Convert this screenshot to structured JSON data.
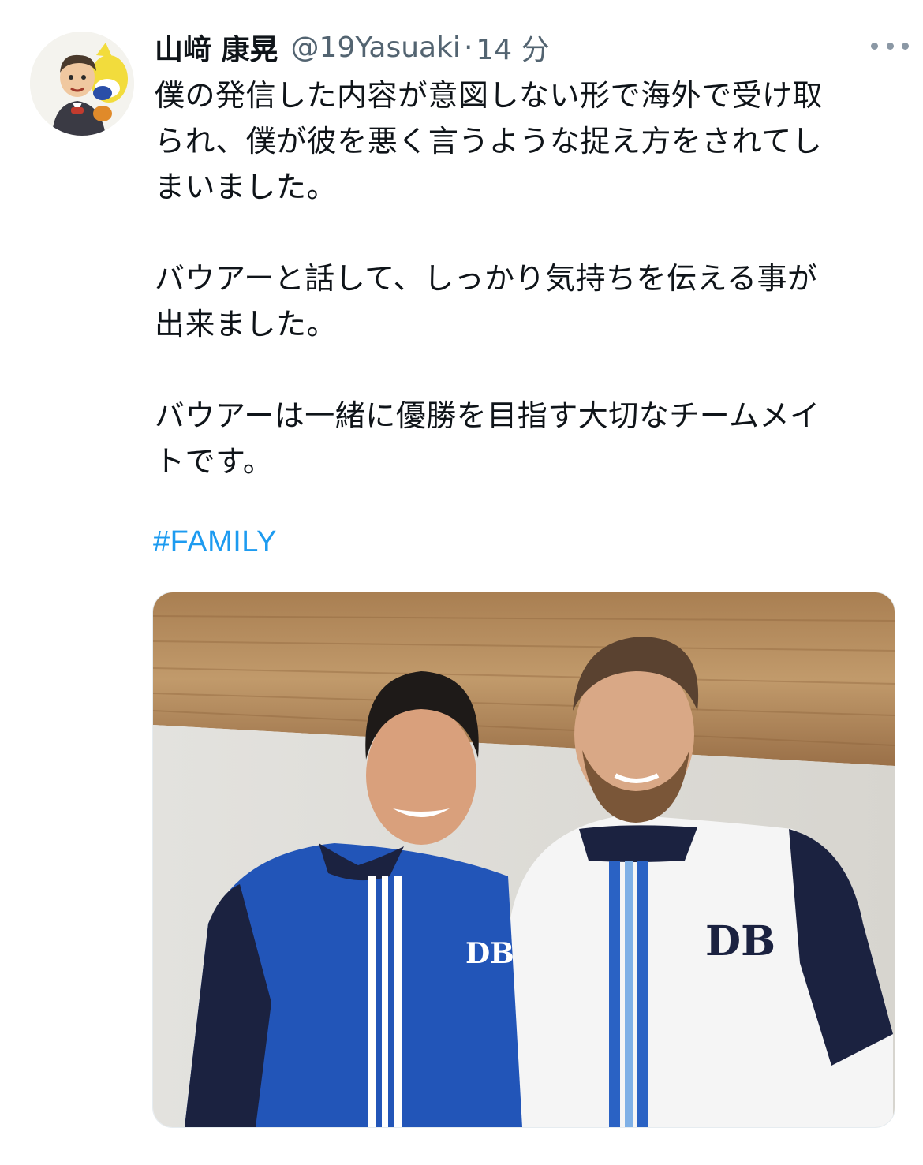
{
  "tweet": {
    "display_name": "山﨑 康晃",
    "handle": "@19Yasuaki",
    "separator": "·",
    "timestamp": "14 分",
    "paragraphs": [
      [
        "僕の発信した内容が意図しない形で海外で受け取",
        "られ、僕が彼を悪く言うような捉え方をされてし",
        "まいました。"
      ],
      [
        "バウアーと話して、しっかり気持ちを伝える事が",
        "出来ました。"
      ],
      [
        "バウアーは一緒に優勝を目指す大切なチームメイ",
        "トです。"
      ]
    ],
    "hashtag": "#FAMILY"
  },
  "icons": {
    "avatar": "illustrated-avatar",
    "more": "more-horizontal-icon"
  },
  "colors": {
    "text": "#0f1419",
    "secondary": "#536471",
    "link": "#1d9bf0",
    "blue_jersey": "#2255b8",
    "navy": "#1b2240"
  }
}
